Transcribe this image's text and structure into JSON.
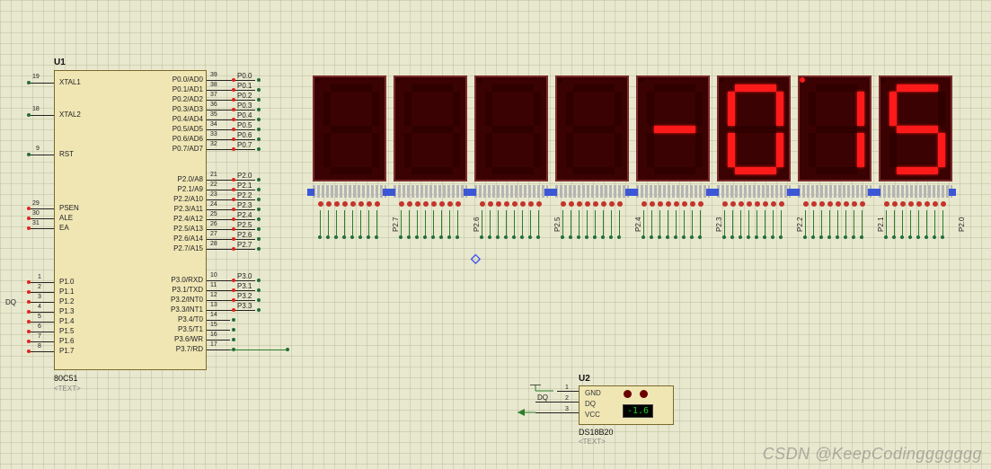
{
  "u1": {
    "ref": "U1",
    "part": "80C51",
    "text_placeholder": "<TEXT>",
    "left_pins": [
      {
        "num": "19",
        "name": "XTAL1"
      },
      {
        "num": "18",
        "name": "XTAL2"
      },
      {
        "num": "9",
        "name": "RST"
      },
      {
        "num": "29",
        "name": "PSEN"
      },
      {
        "num": "30",
        "name": "ALE"
      },
      {
        "num": "31",
        "name": "EA"
      },
      {
        "num": "1",
        "name": "P1.0"
      },
      {
        "num": "2",
        "name": "P1.1"
      },
      {
        "num": "3",
        "name": "P1.2"
      },
      {
        "num": "4",
        "name": "P1.3"
      },
      {
        "num": "5",
        "name": "P1.4"
      },
      {
        "num": "6",
        "name": "P1.5"
      },
      {
        "num": "7",
        "name": "P1.6"
      },
      {
        "num": "8",
        "name": "P1.7"
      }
    ],
    "right_pins": [
      {
        "num": "39",
        "name": "P0.0/AD0",
        "lbl": "P0.0"
      },
      {
        "num": "38",
        "name": "P0.1/AD1",
        "lbl": "P0.1"
      },
      {
        "num": "37",
        "name": "P0.2/AD2",
        "lbl": "P0.2"
      },
      {
        "num": "36",
        "name": "P0.3/AD3",
        "lbl": "P0.3"
      },
      {
        "num": "35",
        "name": "P0.4/AD4",
        "lbl": "P0.4"
      },
      {
        "num": "34",
        "name": "P0.5/AD5",
        "lbl": "P0.5"
      },
      {
        "num": "33",
        "name": "P0.6/AD6",
        "lbl": "P0.6"
      },
      {
        "num": "32",
        "name": "P0.7/AD7",
        "lbl": "P0.7"
      },
      {
        "num": "21",
        "name": "P2.0/A8",
        "lbl": "P2.0"
      },
      {
        "num": "22",
        "name": "P2.1/A9",
        "lbl": "P2.1"
      },
      {
        "num": "23",
        "name": "P2.2/A10",
        "lbl": "P2.2"
      },
      {
        "num": "24",
        "name": "P2.3/A11",
        "lbl": "P2.3"
      },
      {
        "num": "25",
        "name": "P2.4/A12",
        "lbl": "P2.4"
      },
      {
        "num": "26",
        "name": "P2.5/A13",
        "lbl": "P2.5"
      },
      {
        "num": "27",
        "name": "P2.6/A14",
        "lbl": "P2.6"
      },
      {
        "num": "28",
        "name": "P2.7/A15",
        "lbl": "P2.7"
      },
      {
        "num": "10",
        "name": "P3.0/RXD",
        "lbl": "P3.0"
      },
      {
        "num": "11",
        "name": "P3.1/TXD",
        "lbl": "P3.1"
      },
      {
        "num": "12",
        "name": "P3.2/INT0",
        "lbl": "P3.2"
      },
      {
        "num": "13",
        "name": "P3.3/INT1",
        "lbl": "P3.3"
      },
      {
        "num": "14",
        "name": "P3.4/T0",
        "lbl": ""
      },
      {
        "num": "15",
        "name": "P3.5/T1",
        "lbl": ""
      },
      {
        "num": "16",
        "name": "P3.6/WR",
        "lbl": ""
      },
      {
        "num": "17",
        "name": "P3.7/RD",
        "lbl": ""
      }
    ],
    "dq_label": "DQ"
  },
  "displays": {
    "enable_labels": [
      "P2.7",
      "P2.6",
      "P2.5",
      "P2.4",
      "P2.3",
      "P2.2",
      "P2.1",
      "P2.0"
    ],
    "digits": [
      {
        "segments": "",
        "dp": false
      },
      {
        "segments": "",
        "dp": false
      },
      {
        "segments": "",
        "dp": false
      },
      {
        "segments": "",
        "dp": false
      },
      {
        "segments": "G",
        "dp": false
      },
      {
        "segments": "ABCDEF",
        "dp": false
      },
      {
        "segments": "BC",
        "dp": true
      },
      {
        "segments": "ACDFG",
        "dp": false
      }
    ]
  },
  "u2": {
    "ref": "U2",
    "part": "DS18B20",
    "text_placeholder": "<TEXT>",
    "pins": [
      {
        "num": "1",
        "name": "GND"
      },
      {
        "num": "2",
        "name": "DQ"
      },
      {
        "num": "3",
        "name": "VCC"
      }
    ],
    "dq_net": "DQ",
    "temperature": "-1.6"
  },
  "watermark": "CSDN @KeepCodinggggggg"
}
